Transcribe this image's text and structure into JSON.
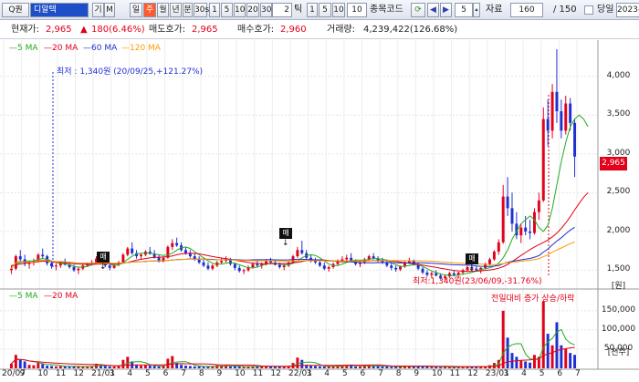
{
  "toolbar": {
    "search_prefix": "Q퀀",
    "stock_name": "디알텍",
    "button_ge": "기",
    "button_m": "M",
    "period_buttons": [
      "일",
      "주",
      "월",
      "년",
      "분",
      "30s"
    ],
    "minute_buttons": [
      "1",
      "5",
      "10",
      "20",
      "30"
    ],
    "tick_value": "2",
    "tick_label": "틱",
    "tick_buttons": [
      "1",
      "5",
      "10"
    ],
    "interval_value": "10",
    "code_label": "종목코드",
    "count_value": "5",
    "data_label": "자료",
    "data_count": "160",
    "total_count": "/ 150",
    "same_day_label": "당일",
    "date_value": "2023-"
  },
  "info": {
    "price_label": "현재가:",
    "price_value": "2,965",
    "change_value": "180(6.46%)",
    "ask_label": "매도호가:",
    "ask_value": "2,965",
    "bid_label": "매수호가:",
    "bid_value": "2,960",
    "volume_label": "거래량:",
    "volume_value": "4,239,422(126.68%)"
  },
  "price_legend": [
    "5 MA",
    "20 MA",
    "60 MA",
    "120 MA"
  ],
  "volume_legend": [
    "5 MA",
    "20 MA"
  ],
  "volume_legend_right": "전일대비 증가 상승/하락",
  "annotations": {
    "low_label": "최저 : 1,340원 (20/09/25,+121.27%)",
    "low_label2": "최저:1,340원(23/06/09,-31.76%)",
    "buy_marks": [
      "매",
      "매",
      "매"
    ]
  },
  "current_price_tag": "2,965",
  "price_unit": "[원]",
  "volume_unit": "[천주]",
  "chart_data": {
    "type": "candlestick",
    "x_tick_labels": [
      "20/07",
      "9",
      "10",
      "11",
      "12",
      "21/01",
      "3",
      "4",
      "5",
      "6",
      "7",
      "8",
      "9",
      "10",
      "11",
      "12",
      "22/01",
      "3",
      "4",
      "5",
      "6",
      "7",
      "8",
      "9",
      "10",
      "11",
      "12",
      "23/01",
      "3",
      "4",
      "5",
      "6",
      "7"
    ],
    "price_ticks": [
      "4,000",
      "3,500",
      "3,000",
      "2,500",
      "2,000",
      "1,500"
    ],
    "price_ylim": [
      1340,
      4350
    ],
    "volume_ticks": [
      "150,000",
      "100,000",
      "50,000"
    ],
    "volume_ylim": [
      0,
      190000
    ],
    "colors": {
      "up": "#e2001a",
      "down": "#1f2fd0",
      "ma5": "#22aa22",
      "ma20": "#e2001a",
      "ma60": "#1f2fd0",
      "ma120": "#ff9900"
    },
    "ohlc": [
      [
        1500,
        1560,
        1450,
        1520
      ],
      [
        1520,
        1700,
        1500,
        1680
      ],
      [
        1680,
        1760,
        1600,
        1640
      ],
      [
        1640,
        1700,
        1550,
        1580
      ],
      [
        1580,
        1620,
        1520,
        1600
      ],
      [
        1600,
        1650,
        1560,
        1620
      ],
      [
        1620,
        1720,
        1600,
        1700
      ],
      [
        1700,
        1780,
        1650,
        1680
      ],
      [
        1680,
        1700,
        1560,
        1590
      ],
      [
        1590,
        1620,
        1520,
        1550
      ],
      [
        1550,
        1590,
        1500,
        1560
      ],
      [
        1560,
        1620,
        1530,
        1600
      ],
      [
        1600,
        1650,
        1560,
        1570
      ],
      [
        1570,
        1600,
        1520,
        1540
      ],
      [
        1540,
        1570,
        1480,
        1500
      ],
      [
        1500,
        1540,
        1450,
        1520
      ],
      [
        1520,
        1580,
        1500,
        1560
      ],
      [
        1560,
        1600,
        1540,
        1590
      ],
      [
        1590,
        1630,
        1560,
        1600
      ],
      [
        1600,
        1680,
        1580,
        1650
      ],
      [
        1650,
        1700,
        1600,
        1610
      ],
      [
        1610,
        1640,
        1540,
        1560
      ],
      [
        1560,
        1590,
        1500,
        1530
      ],
      [
        1530,
        1580,
        1520,
        1570
      ],
      [
        1570,
        1620,
        1550,
        1600
      ],
      [
        1600,
        1720,
        1590,
        1700
      ],
      [
        1700,
        1800,
        1680,
        1780
      ],
      [
        1780,
        1860,
        1700,
        1720
      ],
      [
        1720,
        1760,
        1650,
        1680
      ],
      [
        1680,
        1720,
        1640,
        1700
      ],
      [
        1700,
        1760,
        1680,
        1740
      ],
      [
        1740,
        1800,
        1700,
        1710
      ],
      [
        1710,
        1760,
        1650,
        1670
      ],
      [
        1670,
        1700,
        1600,
        1620
      ],
      [
        1620,
        1680,
        1600,
        1660
      ],
      [
        1660,
        1820,
        1650,
        1800
      ],
      [
        1800,
        1900,
        1760,
        1850
      ],
      [
        1850,
        1920,
        1800,
        1820
      ],
      [
        1820,
        1860,
        1740,
        1760
      ],
      [
        1760,
        1800,
        1700,
        1720
      ],
      [
        1720,
        1760,
        1660,
        1680
      ],
      [
        1680,
        1720,
        1620,
        1640
      ],
      [
        1640,
        1680,
        1580,
        1600
      ],
      [
        1600,
        1640,
        1540,
        1560
      ],
      [
        1560,
        1600,
        1500,
        1520
      ],
      [
        1520,
        1580,
        1500,
        1560
      ],
      [
        1560,
        1620,
        1540,
        1600
      ],
      [
        1600,
        1660,
        1580,
        1620
      ],
      [
        1620,
        1680,
        1600,
        1640
      ],
      [
        1640,
        1660,
        1560,
        1580
      ],
      [
        1580,
        1600,
        1500,
        1530
      ],
      [
        1530,
        1560,
        1470,
        1490
      ],
      [
        1490,
        1520,
        1450,
        1500
      ],
      [
        1500,
        1560,
        1480,
        1540
      ],
      [
        1540,
        1600,
        1520,
        1580
      ],
      [
        1580,
        1620,
        1540,
        1560
      ],
      [
        1560,
        1600,
        1520,
        1580
      ],
      [
        1580,
        1640,
        1560,
        1620
      ],
      [
        1620,
        1660,
        1580,
        1600
      ],
      [
        1600,
        1640,
        1560,
        1570
      ],
      [
        1570,
        1600,
        1520,
        1540
      ],
      [
        1540,
        1580,
        1500,
        1560
      ],
      [
        1560,
        1620,
        1540,
        1600
      ],
      [
        1600,
        1700,
        1580,
        1680
      ],
      [
        1680,
        1800,
        1660,
        1760
      ],
      [
        1760,
        1880,
        1700,
        1720
      ],
      [
        1720,
        1760,
        1640,
        1660
      ],
      [
        1660,
        1700,
        1600,
        1620
      ],
      [
        1620,
        1660,
        1580,
        1600
      ],
      [
        1600,
        1640,
        1540,
        1560
      ],
      [
        1560,
        1600,
        1500,
        1520
      ],
      [
        1520,
        1560,
        1480,
        1540
      ],
      [
        1540,
        1600,
        1520,
        1580
      ],
      [
        1580,
        1640,
        1560,
        1620
      ],
      [
        1620,
        1680,
        1600,
        1640
      ],
      [
        1640,
        1700,
        1620,
        1660
      ],
      [
        1660,
        1720,
        1600,
        1610
      ],
      [
        1610,
        1640,
        1560,
        1580
      ],
      [
        1580,
        1620,
        1540,
        1600
      ],
      [
        1600,
        1660,
        1580,
        1640
      ],
      [
        1640,
        1700,
        1620,
        1680
      ],
      [
        1680,
        1720,
        1640,
        1650
      ],
      [
        1650,
        1680,
        1600,
        1620
      ],
      [
        1620,
        1660,
        1580,
        1600
      ],
      [
        1600,
        1640,
        1540,
        1560
      ],
      [
        1560,
        1600,
        1500,
        1530
      ],
      [
        1530,
        1560,
        1480,
        1510
      ],
      [
        1510,
        1560,
        1490,
        1550
      ],
      [
        1550,
        1620,
        1530,
        1600
      ],
      [
        1600,
        1660,
        1580,
        1620
      ],
      [
        1620,
        1640,
        1560,
        1570
      ],
      [
        1570,
        1600,
        1500,
        1520
      ],
      [
        1520,
        1540,
        1450,
        1470
      ],
      [
        1470,
        1500,
        1420,
        1440
      ],
      [
        1440,
        1480,
        1400,
        1460
      ],
      [
        1460,
        1500,
        1420,
        1430
      ],
      [
        1430,
        1460,
        1380,
        1400
      ],
      [
        1400,
        1440,
        1360,
        1420
      ],
      [
        1420,
        1480,
        1400,
        1460
      ],
      [
        1460,
        1500,
        1420,
        1440
      ],
      [
        1440,
        1480,
        1400,
        1470
      ],
      [
        1470,
        1520,
        1440,
        1500
      ],
      [
        1500,
        1560,
        1480,
        1540
      ],
      [
        1540,
        1600,
        1500,
        1520
      ],
      [
        1520,
        1560,
        1480,
        1500
      ],
      [
        1500,
        1540,
        1460,
        1530
      ],
      [
        1530,
        1600,
        1510,
        1580
      ],
      [
        1580,
        1660,
        1560,
        1640
      ],
      [
        1640,
        1760,
        1620,
        1740
      ],
      [
        1740,
        1900,
        1700,
        1860
      ],
      [
        1860,
        2600,
        1840,
        2450
      ],
      [
        2450,
        2700,
        2200,
        2300
      ],
      [
        2300,
        2500,
        2000,
        2100
      ],
      [
        2100,
        2250,
        1900,
        1950
      ],
      [
        1950,
        2100,
        1850,
        2050
      ],
      [
        2050,
        2200,
        1950,
        2000
      ],
      [
        2000,
        2150,
        1900,
        1980
      ],
      [
        1980,
        2300,
        1960,
        2250
      ],
      [
        2250,
        2500,
        2150,
        2400
      ],
      [
        2400,
        3600,
        2380,
        3450
      ],
      [
        3450,
        3700,
        3100,
        3300
      ],
      [
        3300,
        3900,
        3200,
        3800
      ],
      [
        3800,
        4350,
        3400,
        3550
      ],
      [
        3550,
        3700,
        3200,
        3300
      ],
      [
        3300,
        3750,
        3250,
        3650
      ],
      [
        3650,
        3720,
        3300,
        3400
      ],
      [
        3400,
        3450,
        2700,
        2965
      ]
    ],
    "ma5": [
      1550,
      1580,
      1600,
      1610,
      1620,
      1620,
      1640,
      1650,
      1640,
      1620,
      1600,
      1590,
      1580,
      1570,
      1550,
      1540,
      1540,
      1550,
      1570,
      1590,
      1600,
      1600,
      1580,
      1560,
      1570,
      1600,
      1640,
      1680,
      1710,
      1720,
      1720,
      1720,
      1710,
      1700,
      1690,
      1700,
      1720,
      1760,
      1790,
      1800,
      1780,
      1740,
      1700,
      1660,
      1620,
      1590,
      1580,
      1580,
      1590,
      1600,
      1590,
      1570,
      1550,
      1530,
      1530,
      1540,
      1560,
      1580,
      1590,
      1590,
      1580,
      1570,
      1570,
      1590,
      1620,
      1660,
      1690,
      1700,
      1690,
      1660,
      1620,
      1580,
      1560,
      1560,
      1580,
      1600,
      1620,
      1630,
      1630,
      1630,
      1640,
      1650,
      1650,
      1640,
      1630,
      1600,
      1570,
      1550,
      1550,
      1560,
      1570,
      1570,
      1550,
      1520,
      1490,
      1470,
      1450,
      1440,
      1430,
      1430,
      1440,
      1450,
      1460,
      1470,
      1490,
      1510,
      1520,
      1530,
      1550,
      1590,
      1660,
      1760,
      1900,
      2000,
      2100,
      2150,
      2200,
      2150,
      2050,
      2000,
      2080,
      2300,
      2600,
      2900,
      3150,
      3350,
      3450,
      3500,
      3450,
      3350
    ],
    "ma20": [
      1560,
      1570,
      1580,
      1590,
      1600,
      1600,
      1610,
      1615,
      1615,
      1610,
      1605,
      1600,
      1595,
      1590,
      1585,
      1580,
      1578,
      1575,
      1575,
      1578,
      1580,
      1582,
      1582,
      1580,
      1582,
      1590,
      1600,
      1615,
      1630,
      1640,
      1650,
      1660,
      1665,
      1668,
      1670,
      1675,
      1685,
      1700,
      1710,
      1718,
      1720,
      1718,
      1712,
      1700,
      1688,
      1676,
      1666,
      1658,
      1650,
      1640,
      1630,
      1620,
      1610,
      1600,
      1592,
      1588,
      1585,
      1584,
      1584,
      1585,
      1586,
      1587,
      1590,
      1595,
      1602,
      1612,
      1622,
      1630,
      1634,
      1634,
      1630,
      1624,
      1618,
      1613,
      1610,
      1610,
      1612,
      1614,
      1616,
      1618,
      1621,
      1624,
      1626,
      1626,
      1624,
      1620,
      1614,
      1606,
      1598,
      1590,
      1582,
      1575,
      1566,
      1556,
      1546,
      1536,
      1526,
      1516,
      1506,
      1498,
      1492,
      1488,
      1486,
      1486,
      1488,
      1492,
      1498,
      1504,
      1512,
      1526,
      1546,
      1574,
      1612,
      1650,
      1690,
      1728,
      1766,
      1800,
      1830,
      1858,
      1890,
      1930,
      1980,
      2040,
      2110,
      2190,
      2280,
      2360,
      2440,
      2500
    ]
  },
  "volume_data": [
    12000,
    35000,
    22000,
    18000,
    9000,
    8000,
    15000,
    11000,
    7000,
    6000,
    5000,
    6000,
    5000,
    4000,
    6000,
    5000,
    4000,
    5000,
    6000,
    12000,
    8000,
    6000,
    5000,
    5000,
    7000,
    22000,
    30000,
    18000,
    9000,
    7000,
    8000,
    7000,
    6000,
    5000,
    6000,
    25000,
    32000,
    14000,
    9000,
    7000,
    6000,
    5000,
    5000,
    4000,
    5000,
    6000,
    8000,
    7000,
    6000,
    5000,
    5000,
    5000,
    4000,
    5000,
    6000,
    5000,
    5000,
    6000,
    5000,
    4000,
    5000,
    5000,
    6000,
    14000,
    28000,
    22000,
    9000,
    7000,
    6000,
    5000,
    5000,
    5000,
    6000,
    7000,
    8000,
    9000,
    7000,
    5000,
    5000,
    6000,
    8000,
    7000,
    6000,
    5000,
    5000,
    4000,
    4000,
    5000,
    6000,
    6000,
    5000,
    5000,
    6000,
    5000,
    4000,
    4000,
    3000,
    4000,
    4000,
    3000,
    4000,
    4000,
    5000,
    5000,
    4000,
    4000,
    5000,
    8000,
    14000,
    22000,
    150000,
    80000,
    40000,
    30000,
    20000,
    18000,
    15000,
    35000,
    30000,
    175000,
    90000,
    60000,
    120000,
    60000,
    50000,
    40000,
    35000
  ]
}
